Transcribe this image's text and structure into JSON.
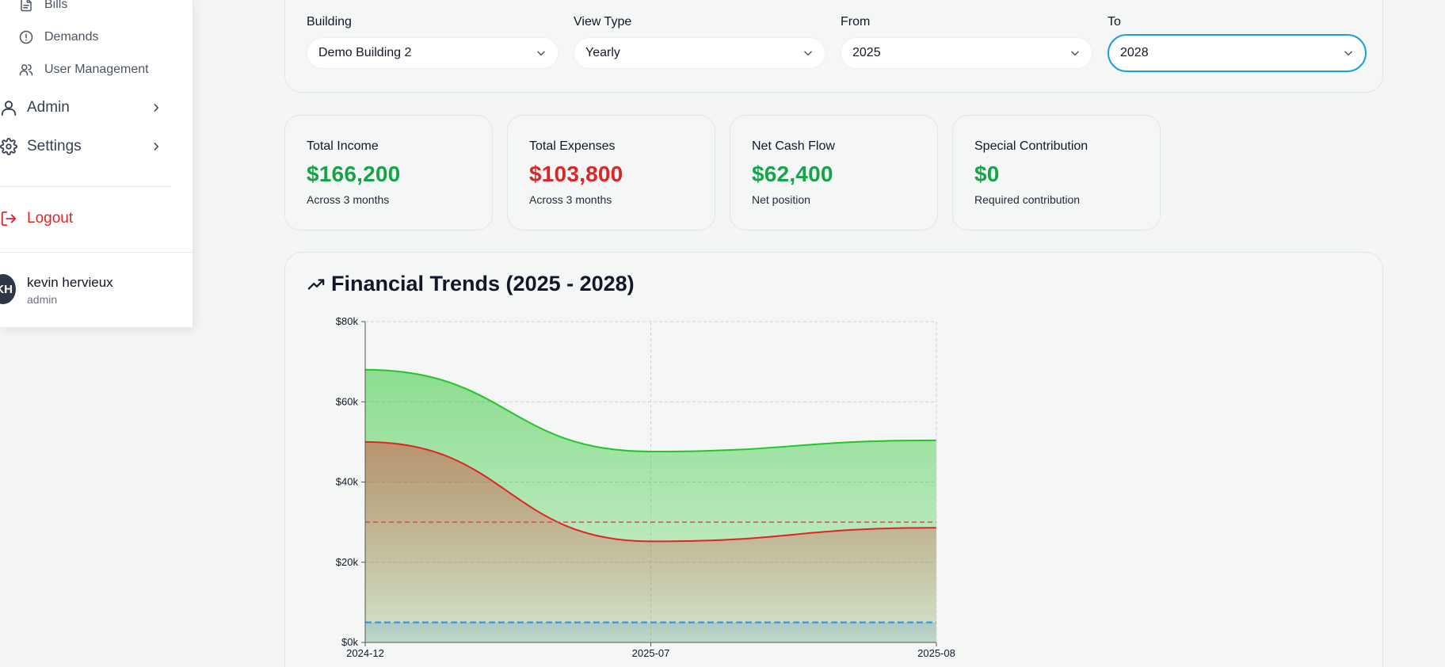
{
  "sidebar": {
    "sub_items": [
      {
        "label": "Bills",
        "icon": "document-icon"
      },
      {
        "label": "Demands",
        "icon": "alert-circle-icon"
      },
      {
        "label": "User Management",
        "icon": "users-icon"
      }
    ],
    "main_items": [
      {
        "label": "Admin",
        "icon": "user-icon"
      },
      {
        "label": "Settings",
        "icon": "gear-icon"
      }
    ],
    "logout_label": "Logout",
    "user": {
      "initials": "KH",
      "name": "kevin hervieux",
      "role": "admin"
    }
  },
  "filters": {
    "building": {
      "label": "Building",
      "value": "Demo Building 2"
    },
    "view_type": {
      "label": "View Type",
      "value": "Yearly"
    },
    "from": {
      "label": "From",
      "value": "2025"
    },
    "to": {
      "label": "To",
      "value": "2028"
    }
  },
  "stats": [
    {
      "title": "Total Income",
      "value": "$166,200",
      "sub": "Across 3 months",
      "color": "green"
    },
    {
      "title": "Total Expenses",
      "value": "$103,800",
      "sub": "Across 3 months",
      "color": "red"
    },
    {
      "title": "Net Cash Flow",
      "value": "$62,400",
      "sub": "Net position",
      "color": "green"
    },
    {
      "title": "Special Contribution",
      "value": "$0",
      "sub": "Required contribution",
      "color": "green"
    }
  ],
  "chart_title": "Financial Trends (2025 - 2028)",
  "colors": {
    "income": "#22c52a",
    "expenses": "#dc2626",
    "expense_reference": "#ef4444",
    "contribution_reference": "#3b9be0",
    "focus_ring": "#1c9fdb"
  },
  "chart_data": {
    "type": "area",
    "categories": [
      "2024-12",
      "2025-07",
      "2025-08"
    ],
    "series": [
      {
        "key": "income",
        "values": [
          68000,
          47600,
          50400
        ]
      },
      {
        "key": "expenses",
        "values": [
          50000,
          25200,
          28600
        ]
      }
    ],
    "reference_lines": [
      {
        "key": "expense_reference",
        "value": 30000,
        "style": "dashed"
      },
      {
        "key": "contribution_reference",
        "value": 5000,
        "style": "dashed"
      }
    ],
    "y_ticks": [
      "$0k",
      "$20k",
      "$40k",
      "$60k",
      "$80k"
    ],
    "ylim": [
      0,
      80000
    ],
    "grid": true
  }
}
